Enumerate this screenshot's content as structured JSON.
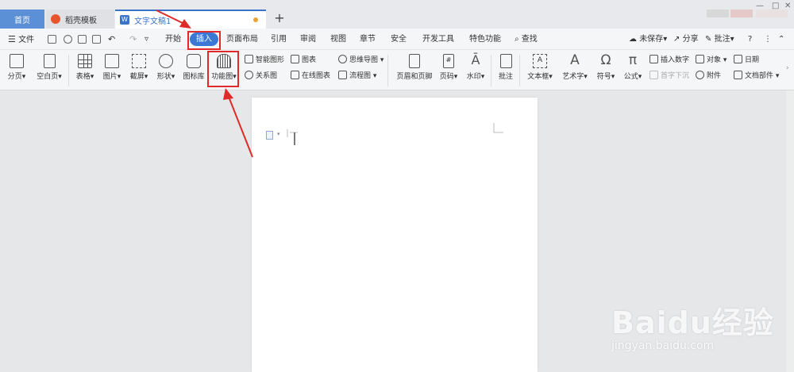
{
  "tabs": {
    "home": "首页",
    "template": "稻壳模板",
    "document": "文字文稿1",
    "new_tab": "+"
  },
  "menu": {
    "file": "文件",
    "items": [
      "开始",
      "插入",
      "页面布局",
      "引用",
      "审阅",
      "视图",
      "章节",
      "安全",
      "开发工具",
      "特色功能"
    ],
    "search": "查找",
    "unsaved": "未保存",
    "share": "分享",
    "comment": "批注",
    "help": "?"
  },
  "ribbon": {
    "page_break": "分页",
    "blank_page": "空白页",
    "table": "表格",
    "picture": "图片",
    "screenshot": "截屏",
    "shape": "形状",
    "icon_library": "图标库",
    "function_chart": "功能图",
    "smart_shape": "智能图形",
    "chart": "图表",
    "mind_map": "思维导图",
    "relation_chart": "关系图",
    "online_chart": "在线图表",
    "flowchart": "流程图",
    "header_footer": "页眉和页脚",
    "page_number": "页码",
    "watermark": "水印",
    "annotate": "批注",
    "textbox": "文本框",
    "wordart": "艺术字",
    "symbol": "符号",
    "formula": "公式",
    "insert_number": "插入数字",
    "object": "对象",
    "date": "日期",
    "drop_cap": "首字下沉",
    "attachment": "附件",
    "doc_parts": "文档部件"
  },
  "watermark_brand": {
    "logo": "Baidu经验",
    "url": "jingyan.baidu.com"
  },
  "colors": {
    "active_tab_accent": "#3b78d4",
    "highlight": "#e02a2a"
  }
}
